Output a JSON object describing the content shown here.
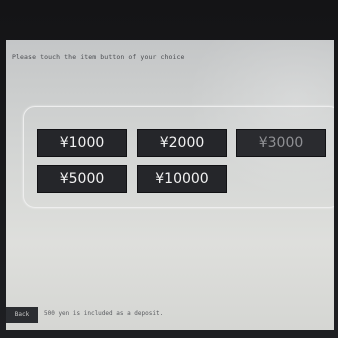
{
  "screen": {
    "instruction": "Please touch the item button of your choice"
  },
  "amounts": [
    {
      "label": "¥1000"
    },
    {
      "label": "¥2000"
    },
    {
      "label": "¥3000"
    },
    {
      "label": "¥5000"
    },
    {
      "label": "¥10000"
    }
  ],
  "footer": {
    "back_label": "Back",
    "deposit_note": "500 yen is included as a deposit."
  },
  "colors": {
    "button_bg": "#25262a",
    "button_text": "#f2f2f2",
    "screen_bg": "#d2d4d3"
  }
}
